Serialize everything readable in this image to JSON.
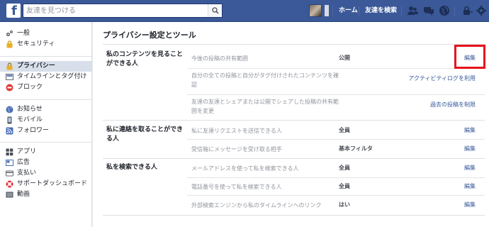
{
  "topbar": {
    "logo": "f",
    "search_placeholder": "友達を見つける",
    "home": "ホーム",
    "find_friends": "友達を検索",
    "icons": [
      "search-icon",
      "friend-requests-icon",
      "messages-icon",
      "notifications-icon",
      "privacy-shortcuts-icon",
      "settings-icon"
    ]
  },
  "sidebar": {
    "groups": [
      [
        {
          "label": "一般",
          "icon": "gears-icon"
        },
        {
          "label": "セキュリティ",
          "icon": "shield-icon"
        }
      ],
      [
        {
          "label": "プライバシー",
          "icon": "lock-icon",
          "active": true
        },
        {
          "label": "タイムラインとタグ付け",
          "icon": "timeline-icon"
        },
        {
          "label": "ブロック",
          "icon": "block-icon"
        }
      ],
      [
        {
          "label": "お知らせ",
          "icon": "globe-icon"
        },
        {
          "label": "モバイル",
          "icon": "mobile-icon"
        },
        {
          "label": "フォロワー",
          "icon": "rss-icon"
        }
      ],
      [
        {
          "label": "アプリ",
          "icon": "apps-icon"
        },
        {
          "label": "広告",
          "icon": "ads-icon"
        },
        {
          "label": "支払い",
          "icon": "payments-icon"
        },
        {
          "label": "サポートダッシュボード",
          "icon": "support-icon"
        },
        {
          "label": "動画",
          "icon": "video-icon"
        }
      ]
    ]
  },
  "main": {
    "title": "プライバシー設定とツール",
    "sections": [
      {
        "title": "私のコンテンツを見ることができる人",
        "rows": [
          {
            "question": "今後の投稿の共有範囲",
            "value": "公開",
            "action": "編集"
          },
          {
            "question": "自分の全ての投稿と自分がタグ付けされたコンテンツを確認",
            "value": "",
            "action": "アクティビティログを利用"
          },
          {
            "question": "友達の友達とシェアまたは公開でシェアした投稿の共有範囲を変更",
            "value": "",
            "action": "過去の投稿を制限"
          }
        ]
      },
      {
        "title": "私に連絡を取ることができる人",
        "rows": [
          {
            "question": "私に友達リクエストを送信できる人",
            "value": "全員",
            "action": "編集"
          },
          {
            "question": "受信箱にメッセージを受け取る相手",
            "value": "基本フィルタ",
            "action": "編集"
          }
        ]
      },
      {
        "title": "私を検索できる人",
        "rows": [
          {
            "question": "メールアドレスを使って私を検索できる人",
            "value": "全員",
            "action": "編集"
          },
          {
            "question": "電話番号を使って私を検索できる人",
            "value": "全員",
            "action": "編集"
          },
          {
            "question": "外部検索エンジンから私のタイムラインへのリンク",
            "value": "はい",
            "action": "編集"
          }
        ]
      }
    ]
  },
  "colors": {
    "brand": "#3b5998",
    "link": "#365899",
    "highlight": "#e5141c"
  }
}
